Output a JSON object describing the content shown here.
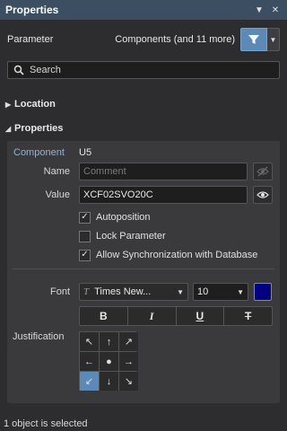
{
  "titlebar": {
    "title": "Properties",
    "pin_icon": "pin-icon",
    "close_icon": "close-icon"
  },
  "parameter": {
    "label": "Parameter",
    "value": "Components (and 11 more)"
  },
  "search": {
    "placeholder": "Search"
  },
  "sections": {
    "location": "Location",
    "properties": "Properties"
  },
  "properties": {
    "component_label": "Component",
    "component_value": "U5",
    "name_label": "Name",
    "name_placeholder": "Comment",
    "value_label": "Value",
    "value_text": "XCF02SVO20C",
    "checks": [
      {
        "label": "Autoposition",
        "checked": true
      },
      {
        "label": "Lock Parameter",
        "checked": false
      },
      {
        "label": "Allow Synchronization with Database",
        "checked": true
      }
    ],
    "font_label": "Font",
    "font_name": "Times New...",
    "font_size": "10",
    "font_color": "#000080",
    "format_buttons": [
      "B",
      "I",
      "U",
      "T"
    ],
    "justification_label": "Justification",
    "justification_cells": [
      "↖",
      "↑",
      "↗",
      "←",
      "●",
      "→",
      "↙",
      "↓",
      "↘"
    ],
    "justification_selected": "bottom-left"
  },
  "status": "1 object is selected",
  "colors": {
    "accent": "#5b8ab8",
    "titlebar": "#3c4e61",
    "background": "#2d2d30"
  }
}
